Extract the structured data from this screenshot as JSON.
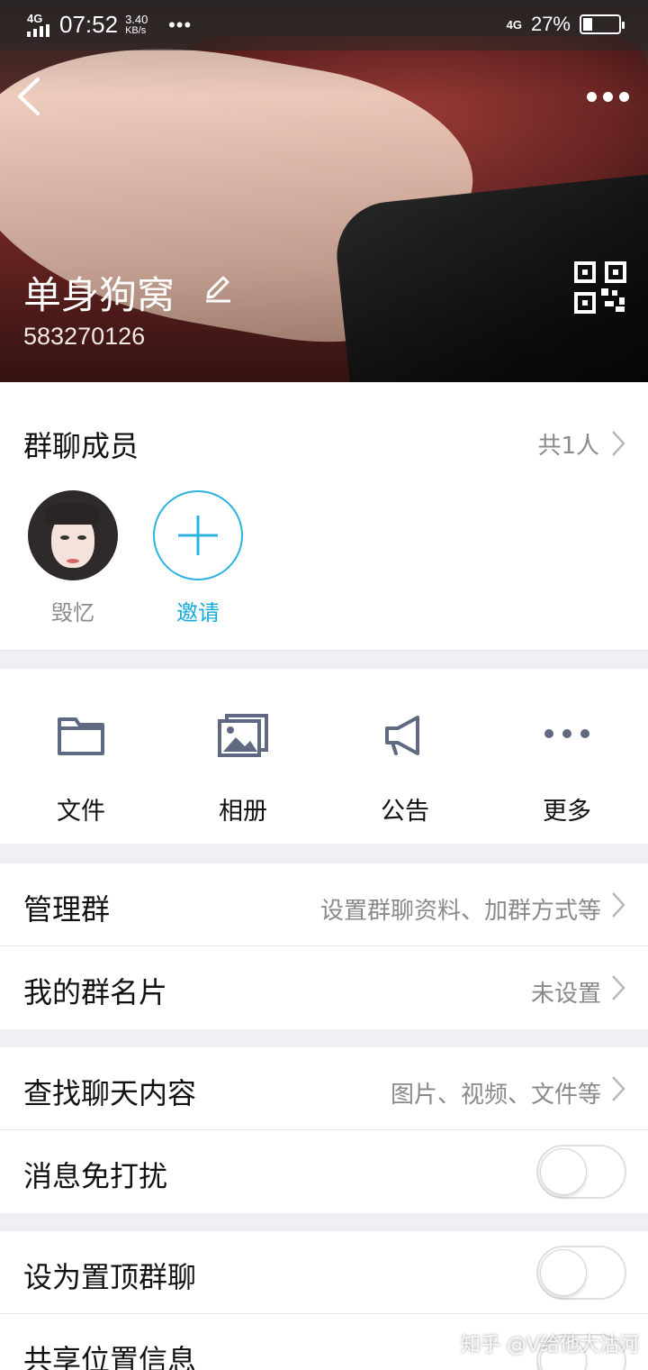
{
  "status_bar": {
    "network": "4G",
    "time": "07:52",
    "speed": "3.40",
    "speed_unit": "KB/s",
    "dots": "•••",
    "network_right": "4G",
    "battery_text": "27%",
    "battery_level": 0.27
  },
  "header": {
    "group_name": "单身狗窝",
    "group_id": "583270126"
  },
  "members": {
    "title": "群聊成员",
    "count": "共1人",
    "items": [
      {
        "name": "毁忆"
      }
    ],
    "invite_label": "邀请"
  },
  "tools": [
    {
      "label": "文件",
      "icon": "folder-icon"
    },
    {
      "label": "相册",
      "icon": "photo-album-icon"
    },
    {
      "label": "公告",
      "icon": "megaphone-icon"
    },
    {
      "label": "更多",
      "icon": "more-dots-icon"
    }
  ],
  "rows": {
    "manage": {
      "title": "管理群",
      "value": "设置群聊资料、加群方式等"
    },
    "card": {
      "title": "我的群名片",
      "value": "未设置"
    },
    "search": {
      "title": "查找聊天内容",
      "value": "图片、视频、文件等"
    },
    "mute": {
      "title": "消息免打扰",
      "enabled": false
    },
    "pin": {
      "title": "设为置顶群聊",
      "enabled": false
    },
    "location": {
      "title": "共享位置信息"
    }
  },
  "watermark": "知乎 @V给他大沽河",
  "colors": {
    "accent": "#16a9da",
    "icon": "#5f6a82",
    "secondary_text": "#8a8a8a"
  }
}
